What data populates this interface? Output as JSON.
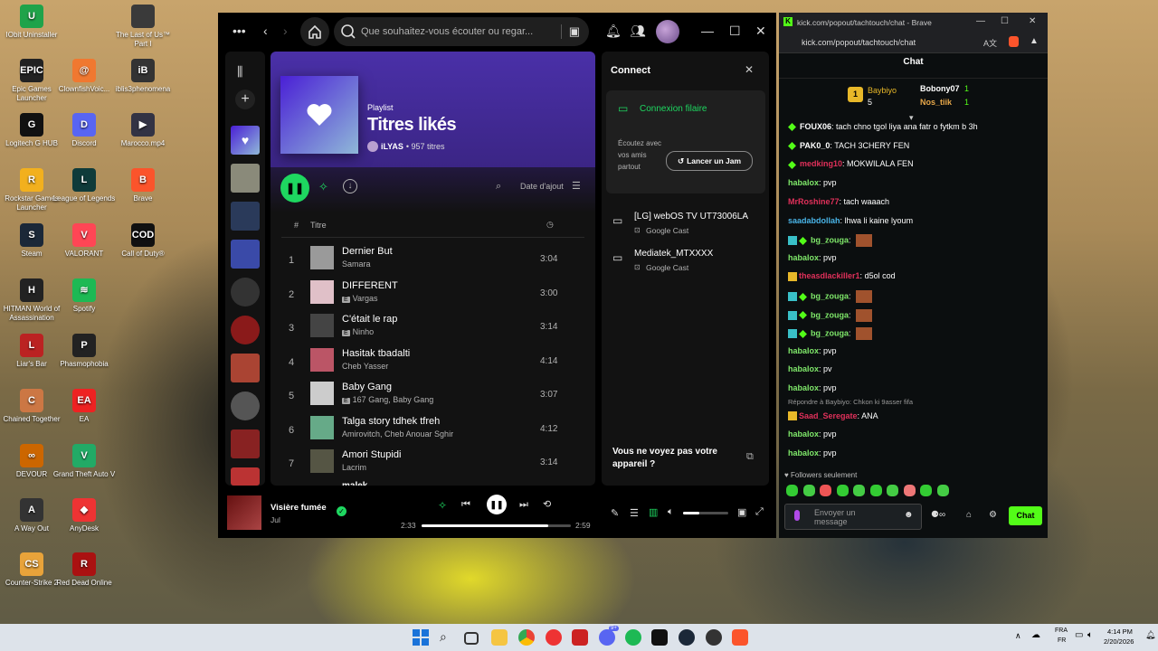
{
  "desktop_icons": [
    {
      "label": "IObit Uninstaller",
      "color": "#1fa34a",
      "glyph": "U"
    },
    {
      "label": "The Last of Us™ Part I",
      "color": "#3a3a3a",
      "glyph": ""
    },
    {
      "label": "Epic Games Launcher",
      "color": "#222",
      "glyph": "EPIC"
    },
    {
      "label": "ClownfishVoic...",
      "color": "#f07830",
      "glyph": "@"
    },
    {
      "label": "iblis3phenomena",
      "color": "#333",
      "glyph": "iB"
    },
    {
      "label": "Logitech G HUB",
      "color": "#111",
      "glyph": "G"
    },
    {
      "label": "Discord",
      "color": "#5865f2",
      "glyph": "D"
    },
    {
      "label": "Marocco.mp4",
      "color": "#334",
      "glyph": "▶"
    },
    {
      "label": "Rockstar Games Launcher",
      "color": "#f2b01e",
      "glyph": "R"
    },
    {
      "label": "League of Legends",
      "color": "#0f3b3a",
      "glyph": "L"
    },
    {
      "label": "Brave",
      "color": "#fb542b",
      "glyph": "B"
    },
    {
      "label": "Steam",
      "color": "#1b2838",
      "glyph": "S"
    },
    {
      "label": "VALORANT",
      "color": "#ff4655",
      "glyph": "V"
    },
    {
      "label": "Call of Duty®",
      "color": "#111",
      "glyph": "COD"
    },
    {
      "label": "HITMAN World of Assassination",
      "color": "#222",
      "glyph": "H"
    },
    {
      "label": "Spotify",
      "color": "#1db954",
      "glyph": "≋"
    },
    {
      "label": "Liar's Bar",
      "color": "#b22",
      "glyph": "L"
    },
    {
      "label": "Phasmophobia",
      "color": "#222",
      "glyph": "P"
    },
    {
      "label": "Chained Together",
      "color": "#c74",
      "glyph": "C"
    },
    {
      "label": "EA",
      "color": "#e22",
      "glyph": "EA"
    },
    {
      "label": "DEVOUR",
      "color": "#c60",
      "glyph": "∞"
    },
    {
      "label": "Grand Theft Auto V",
      "color": "#2a6",
      "glyph": "V"
    },
    {
      "label": "A Way Out",
      "color": "#333",
      "glyph": "A"
    },
    {
      "label": "AnyDesk",
      "color": "#e33",
      "glyph": "◆"
    },
    {
      "label": "Counter-Strike 2",
      "color": "#e8a33a",
      "glyph": "CS"
    },
    {
      "label": "Red Dead Online",
      "color": "#a11",
      "glyph": "R"
    }
  ],
  "spotify": {
    "search_placeholder": "Que souhaitez-vous écouter ou regar...",
    "playlist": {
      "kind": "Playlist",
      "title": "Titres likés",
      "owner": "iLYAS",
      "count": "• 957 titres",
      "sort_label": "Date d'ajout",
      "col_number": "#",
      "col_title": "Titre"
    },
    "tracks": [
      {
        "num": "1",
        "title": "Dernier But",
        "artist": "Samara",
        "explicit": false,
        "duration": "3:04",
        "color": "#9a9a9a"
      },
      {
        "num": "2",
        "title": "DIFFERENT",
        "artist": "Vargas",
        "explicit": true,
        "duration": "3:00",
        "color": "#e0c0c8"
      },
      {
        "num": "3",
        "title": "C'était le rap",
        "artist": "Ninho",
        "explicit": true,
        "duration": "3:14",
        "color": "#444"
      },
      {
        "num": "4",
        "title": "Hasitak tbadalti",
        "artist": "Cheb Yasser",
        "explicit": false,
        "duration": "4:14",
        "color": "#b56"
      },
      {
        "num": "5",
        "title": "Baby Gang",
        "artist": "167 Gang, Baby Gang",
        "explicit": true,
        "duration": "3:07",
        "color": "#ccc"
      },
      {
        "num": "6",
        "title": "Talga story tdhek tfreh",
        "artist": "Amirovitch, Cheb Anouar Sghir",
        "explicit": false,
        "duration": "4:12",
        "color": "#6a8"
      },
      {
        "num": "7",
        "title": "Amori Stupidi",
        "artist": "Lacrim",
        "explicit": false,
        "duration": "3:14",
        "color": "#554"
      }
    ],
    "partial_track": "malek",
    "connect": {
      "title": "Connect",
      "wired": "Connexion filaire",
      "jam_text": "Écoutez avec vos amis partout",
      "jam_button": "Lancer un Jam",
      "devices": [
        {
          "name": "[LG] webOS TV UT73006LA",
          "type": "Google Cast"
        },
        {
          "name": "Mediatek_MTXXXX",
          "type": "Google Cast"
        }
      ],
      "footer": "Vous ne voyez pas votre appareil ?"
    },
    "player": {
      "song": "Visière fumée",
      "artist": "Jul",
      "elapsed": "2:33",
      "total": "2:59",
      "progress": 0.85,
      "volume": 0.35
    }
  },
  "kick": {
    "window_title": "kick.com/popout/tachtouch/chat - Brave",
    "url": "kick.com/popout/tachtouch/chat",
    "header": "Chat",
    "leaderboard": [
      {
        "rank": "1",
        "name": "Baybiyo",
        "count": "5"
      },
      {
        "rank": "",
        "name": "Bobony07",
        "count": "1"
      },
      {
        "rank": "",
        "name": "Nos_tiik",
        "count": "1"
      }
    ],
    "messages": [
      {
        "user": "FOUX06",
        "color": "#ffffff",
        "text": "tach chno tgol liya ana fatr o fytkm b 3h",
        "badge": "green"
      },
      {
        "user": "PAK0_0",
        "color": "#ffffff",
        "text": "TACH 3CHERY FEN",
        "badge": "green"
      },
      {
        "user": "medking10",
        "color": "#e0305a",
        "text": "MOKWILALA FEN",
        "badge": "green"
      },
      {
        "user": "habalox",
        "color": "#7fe86a",
        "text": "pvp",
        "badge": ""
      },
      {
        "user": "MrRoshine77",
        "color": "#e0305a",
        "text": "tach waaach",
        "badge": ""
      },
      {
        "user": "saadabdollah",
        "color": "#4ab5e8",
        "text": "lhwa li kaine lyoum",
        "badge": ""
      },
      {
        "user": "bg_zouga",
        "color": "#7fe86a",
        "text": "",
        "badge": "multi",
        "emote": true
      },
      {
        "user": "habalox",
        "color": "#7fe86a",
        "text": "pvp",
        "badge": ""
      },
      {
        "user": "theasdlackiller1",
        "color": "#e0305a",
        "text": "d5ol cod",
        "badge": "crown"
      },
      {
        "user": "bg_zouga",
        "color": "#7fe86a",
        "text": "",
        "badge": "multi",
        "emote": true
      },
      {
        "user": "bg_zouga",
        "color": "#7fe86a",
        "text": "",
        "badge": "multi",
        "emote": true
      },
      {
        "user": "bg_zouga",
        "color": "#7fe86a",
        "text": "",
        "badge": "multi",
        "emote": true
      },
      {
        "user": "habalox",
        "color": "#7fe86a",
        "text": "pvp",
        "badge": ""
      },
      {
        "user": "habalox",
        "color": "#7fe86a",
        "text": "pv",
        "badge": ""
      },
      {
        "user": "habalox",
        "color": "#7fe86a",
        "text": "pvp",
        "badge": ""
      },
      {
        "user": "Saad_Seregate",
        "color": "#e0305a",
        "text": "ANA",
        "badge": "crown",
        "reply": "Répondre à Baybiyo: Chkon ki 9asser fifa"
      },
      {
        "user": "habalox",
        "color": "#7fe86a",
        "text": "pvp",
        "badge": ""
      },
      {
        "user": "habalox",
        "color": "#7fe86a",
        "text": "pvp",
        "badge": ""
      }
    ],
    "followers_only": "Followers seulement",
    "input_placeholder": "Envoyer un message",
    "send_button": "Chat"
  },
  "taskbar": {
    "lang_top": "FRA",
    "lang_bottom": "FR",
    "time": "4:14 PM",
    "date": "2/20/2026",
    "discord_badge": "9+"
  },
  "colors": {
    "spotify_green": "#1ed760",
    "kick_green": "#53fc18"
  }
}
